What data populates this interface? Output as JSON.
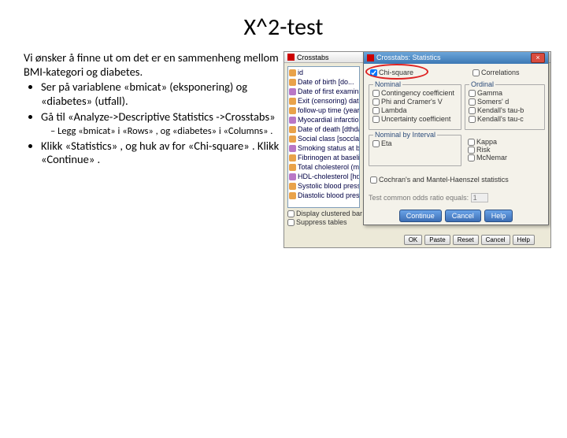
{
  "slide": {
    "title": "X^2-test",
    "intro": "Vi ønsker å finne ut om det er en sammenheng mellom BMI-kategori og diabetes.",
    "b1": "Ser på variablene «bmicat» (eksponering) og «diabetes» (utfall).",
    "b2": "Gå til «Analyze->Descriptive Statistics ->Crosstabs»",
    "sub": "Legg «bmicat» i «Rows» , og «diabetes» i «Columns» .",
    "b3": "Klikk «Statistics» , og huk av for «Chi-square» . Klikk «Continue» ."
  },
  "crosstabs": {
    "title": "Crosstabs",
    "vars": [
      "id",
      "Date of birth [do...",
      "Date of first examination",
      "Exit (censoring) date for",
      "follow-up time (years) [f...",
      "Myocardial infarction or...",
      "Date of death [dthdate]",
      "Social class [socclass]",
      "Smoking status at base...",
      "Fibrinogen at baseline [...",
      "Total cholesterol (mmo...",
      "HDL-cholesterol [hdlcho...",
      "Systolic blood pressure...",
      "Diastolic blood pressure..."
    ],
    "opt1": "Display clustered bar charts",
    "opt2": "Suppress tables",
    "b_ok": "OK",
    "b_paste": "Paste",
    "b_reset": "Reset",
    "b_cancel": "Cancel",
    "b_help": "Help"
  },
  "stats": {
    "title": "Crosstabs: Statistics",
    "chi": "Chi-square",
    "corr": "Correlations",
    "nominal_title": "Nominal",
    "nominal": [
      "Contingency coefficient",
      "Phi and Cramer's V",
      "Lambda",
      "Uncertainty coefficient"
    ],
    "ordinal_title": "Ordinal",
    "ordinal": [
      "Gamma",
      "Somers' d",
      "Kendall's tau-b",
      "Kendall's tau-c"
    ],
    "nbi_title": "Nominal by Interval",
    "nbi": [
      "Eta"
    ],
    "right": [
      "Kappa",
      "Risk",
      "McNemar"
    ],
    "coch": "Cochran's and Mantel-Haenszel statistics",
    "least": "Test common odds ratio equals:",
    "least_val": "1",
    "btn_cont": "Continue",
    "btn_cancel": "Cancel",
    "btn_help": "Help"
  }
}
